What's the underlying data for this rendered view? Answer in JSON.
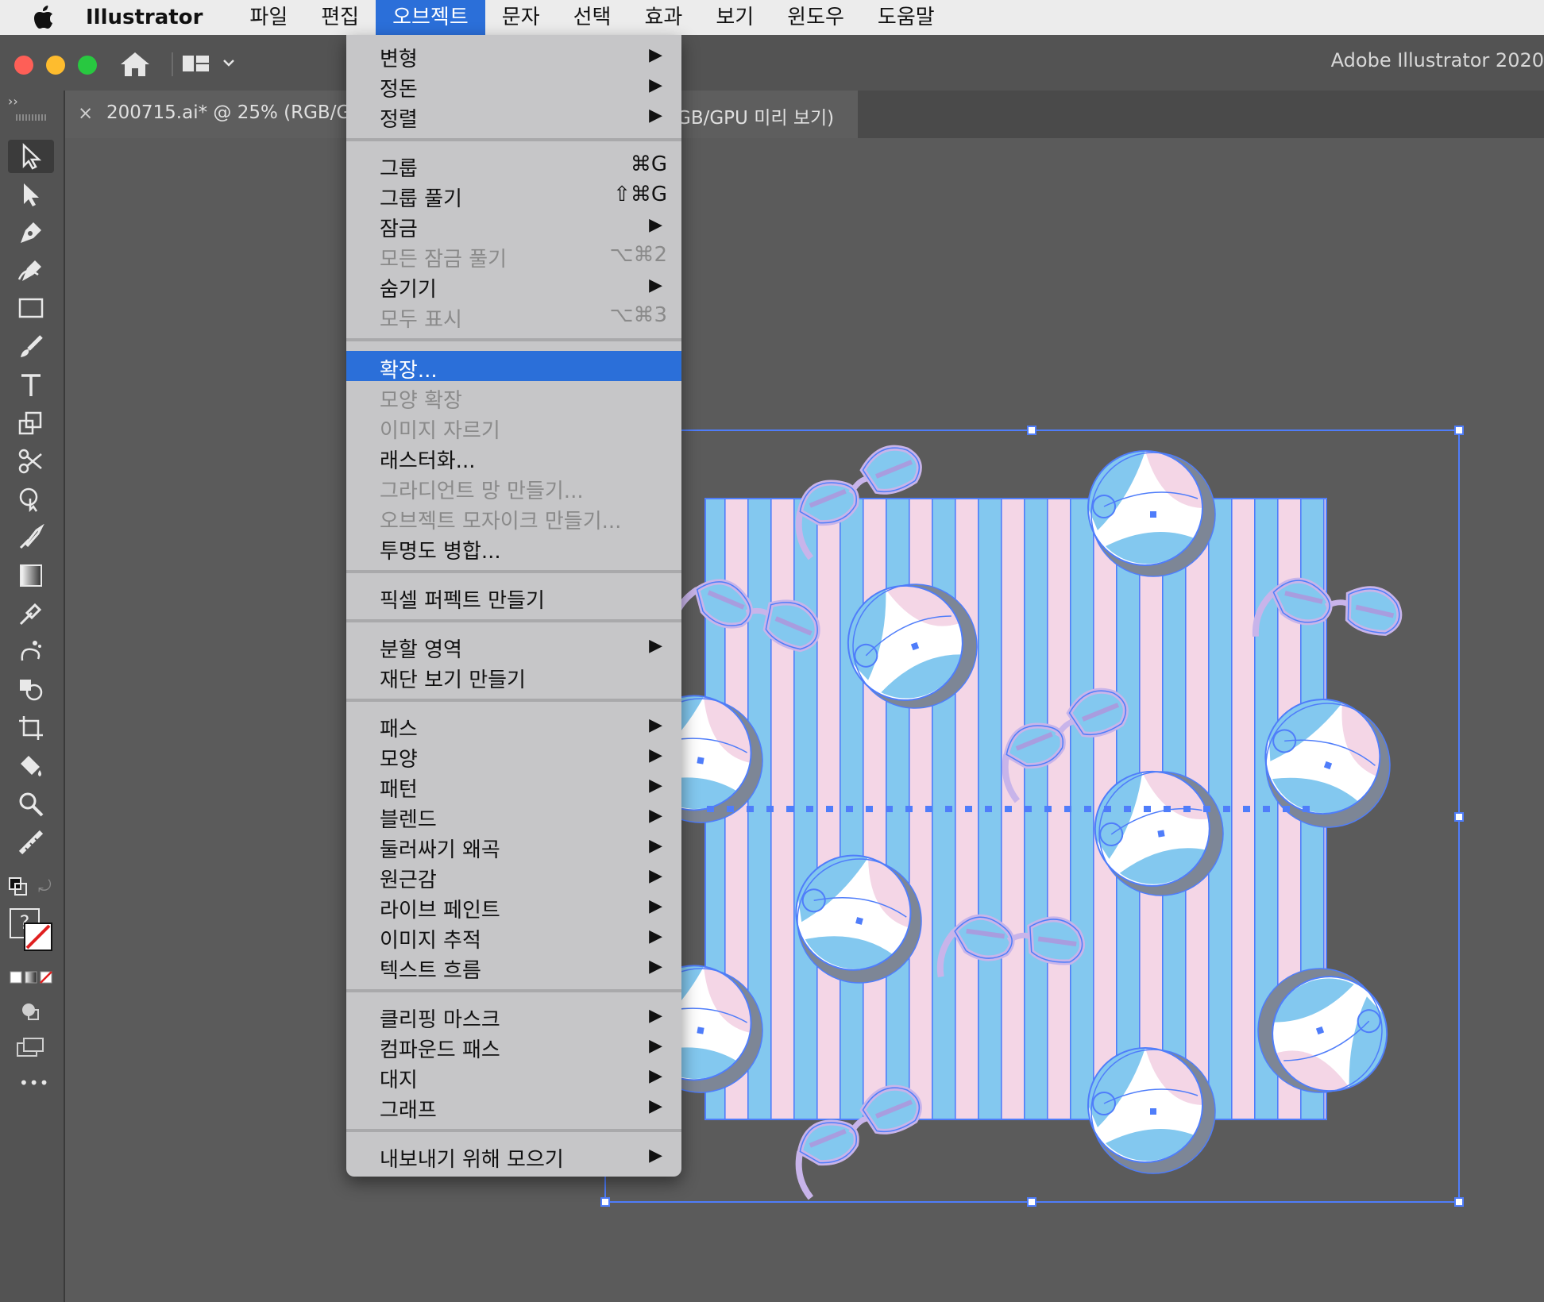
{
  "menubar": {
    "app_name": "Illustrator",
    "items": [
      "파일",
      "편집",
      "오브젝트",
      "문자",
      "선택",
      "효과",
      "보기",
      "윈도우",
      "도움말"
    ],
    "active_item": "오브젝트"
  },
  "appbar": {
    "title": "Adobe Illustrator 2020"
  },
  "document_tab": {
    "title_left": "200715.ai* @ 25% (RGB/G",
    "title_right": "GB/GPU 미리 보기)",
    "close": "×"
  },
  "object_menu": {
    "items": [
      {
        "label": "변형",
        "submenu": true
      },
      {
        "label": "정돈",
        "submenu": true
      },
      {
        "label": "정렬",
        "submenu": true
      },
      {
        "label": "그룹",
        "shortcut": "⌘G"
      },
      {
        "label": "그룹 풀기",
        "shortcut": "⇧⌘G"
      },
      {
        "label": "잠금",
        "submenu": true
      },
      {
        "label": "모든 잠금 풀기",
        "shortcut": "⌥⌘2",
        "disabled": true
      },
      {
        "label": "숨기기",
        "submenu": true
      },
      {
        "label": "모두 표시",
        "shortcut": "⌥⌘3",
        "disabled": true
      },
      {
        "label": "확장...",
        "highlighted": true
      },
      {
        "label": "모양 확장",
        "disabled": true
      },
      {
        "label": "이미지 자르기",
        "disabled": true
      },
      {
        "label": "래스터화..."
      },
      {
        "label": "그라디언트 망 만들기...",
        "disabled": true
      },
      {
        "label": "오브젝트 모자이크 만들기...",
        "disabled": true
      },
      {
        "label": "투명도 병합..."
      },
      {
        "label": "픽셀 퍼펙트 만들기"
      },
      {
        "label": "분할 영역",
        "submenu": true
      },
      {
        "label": "재단 보기 만들기"
      },
      {
        "label": "패스",
        "submenu": true
      },
      {
        "label": "모양",
        "submenu": true
      },
      {
        "label": "패턴",
        "submenu": true
      },
      {
        "label": "블렌드",
        "submenu": true
      },
      {
        "label": "둘러싸기 왜곡",
        "submenu": true
      },
      {
        "label": "원근감",
        "submenu": true
      },
      {
        "label": "라이브 페인트",
        "submenu": true
      },
      {
        "label": "이미지 추적",
        "submenu": true
      },
      {
        "label": "텍스트 흐름",
        "submenu": true
      },
      {
        "label": "클리핑 마스크",
        "submenu": true
      },
      {
        "label": "컴파운드 패스",
        "submenu": true
      },
      {
        "label": "대지",
        "submenu": true
      },
      {
        "label": "그래프",
        "submenu": true
      },
      {
        "label": "내보내기 위해 모으기",
        "submenu": true
      }
    ],
    "submenu_arrow": "▶"
  },
  "toolbar": {
    "tools": [
      "selection-tool",
      "direct-selection-tool",
      "pen-tool",
      "curvature-tool",
      "rectangle-tool",
      "paintbrush-tool",
      "type-tool",
      "scale-tool",
      "scissors-tool",
      "puppet-warp-tool",
      "shaper-tool",
      "gradient-tool",
      "eyedropper-tool",
      "symbol-sprayer-tool",
      "shape-builder-tool",
      "artboard-tool",
      "live-paint-tool",
      "zoom-tool",
      "measure-tool"
    ],
    "fill_stroke_label": "?",
    "more_label": "•••"
  },
  "colors": {
    "accent": "#2b6fd9",
    "stripe_blue": "#83c8ef",
    "stripe_pink": "#f4d6e6",
    "selection": "#4f7dfa"
  }
}
